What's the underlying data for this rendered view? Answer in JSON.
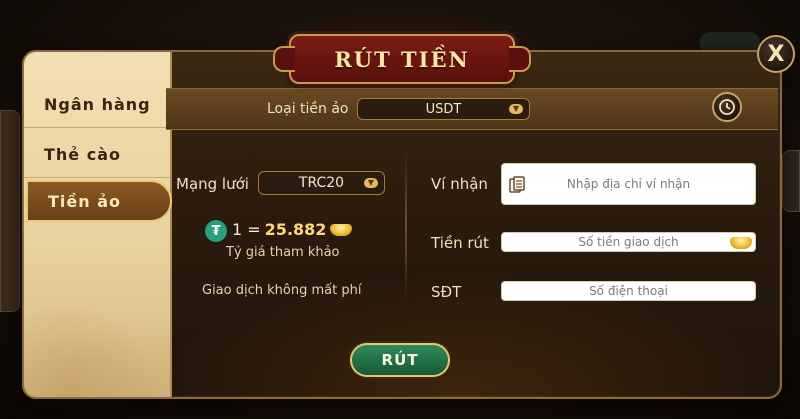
{
  "title": "RÚT TIỀN",
  "sidebar": {
    "items": [
      {
        "label": "Ngân hàng"
      },
      {
        "label": "Thẻ cào"
      },
      {
        "label": "Tiền ảo"
      }
    ],
    "active_index": 2
  },
  "currency": {
    "label": "Loại tiền ảo",
    "value": "USDT"
  },
  "network": {
    "label": "Mạng lưới",
    "value": "TRC20"
  },
  "rate": {
    "prefix": "1 =",
    "value": "25.882",
    "caption": "Tỷ giá tham khảo"
  },
  "fee_note": "Giao dịch không mất phí",
  "wallet": {
    "label": "Ví nhận",
    "placeholder": "Nhập địa chỉ ví nhận"
  },
  "amount": {
    "label": "Tiền rút",
    "placeholder": "Số tiền giao dịch"
  },
  "phone": {
    "label": "SĐT",
    "placeholder": "Số điện thoại"
  },
  "submit_label": "RÚT",
  "close_label": "X",
  "colors": {
    "accent_gold": "#e9c56f",
    "submit_green": "#2f8a5c",
    "title_red": "#7a1c14",
    "tether_green": "#26a17b"
  },
  "icons": [
    "close-icon",
    "history-icon",
    "clipboard-icon",
    "tether-icon",
    "gold-ingot-icon",
    "dropdown-arrow-icon"
  ]
}
